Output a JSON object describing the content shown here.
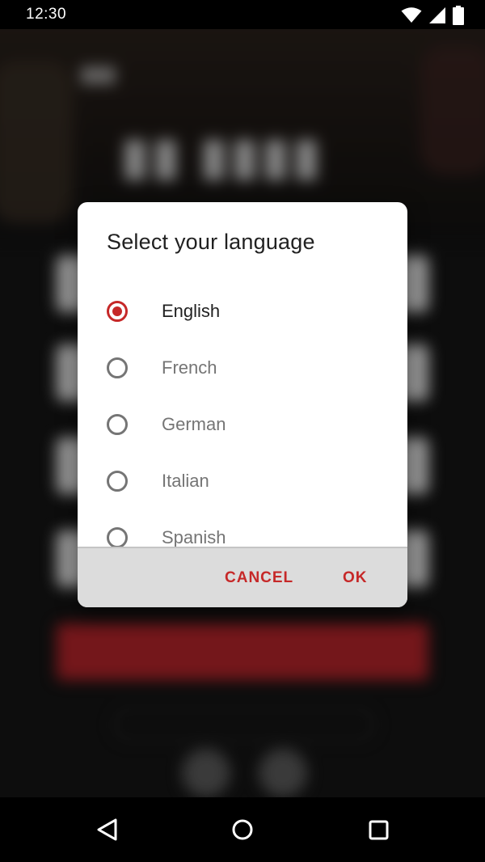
{
  "status_bar": {
    "time": "12:30",
    "icons": [
      "wifi-icon",
      "cellular-signal-icon",
      "battery-icon"
    ]
  },
  "background": {
    "description_colors": {
      "hero": "#2a221c",
      "accent_red": "#b3242a",
      "field": "#e8e8e8"
    }
  },
  "dialog": {
    "title": "Select your language",
    "options": [
      {
        "label": "English",
        "selected": true
      },
      {
        "label": "French",
        "selected": false
      },
      {
        "label": "German",
        "selected": false
      },
      {
        "label": "Italian",
        "selected": false
      },
      {
        "label": "Spanish",
        "selected": false
      }
    ],
    "cancel_label": "CANCEL",
    "ok_label": "OK"
  },
  "colors": {
    "accent": "#c62828",
    "dialog_bg": "#ffffff",
    "actions_bg": "#dcdcdc",
    "text_primary": "#212121",
    "text_secondary": "#757575"
  },
  "nav_bar": {
    "buttons": [
      "back-icon",
      "home-icon",
      "recents-icon"
    ]
  }
}
